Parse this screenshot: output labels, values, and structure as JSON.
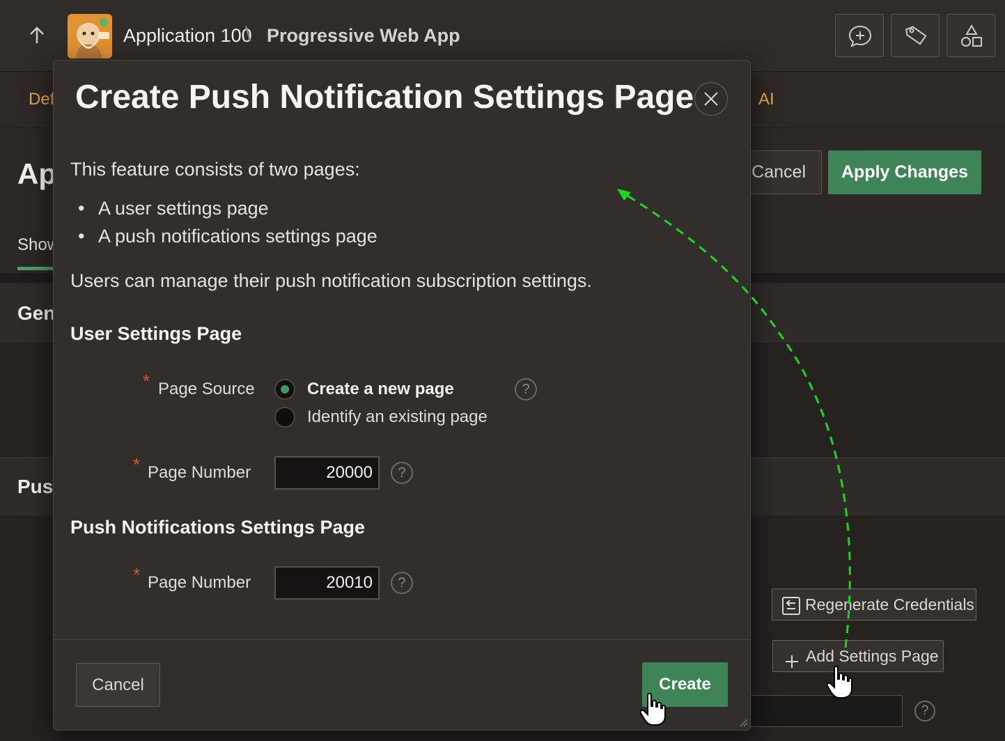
{
  "header": {
    "app_name": "Application 100",
    "crumb_separator": "\\",
    "page_name": "Progressive Web App",
    "tools": [
      "comment-add-icon",
      "tag-icon",
      "shapes-icon"
    ]
  },
  "tabs": {
    "left_label": "Def",
    "right_label": "AI"
  },
  "background": {
    "page_heading": "Ap",
    "show_label": "Show",
    "cancel_label": "Cancel",
    "apply_label": "Apply Changes",
    "general_region": "Gen",
    "push_region": "Pusl",
    "regen_label": "Regenerate Credentials",
    "add_settings_label": "Add Settings Page",
    "help_glyph": "?"
  },
  "dialog": {
    "title": "Create Push Notification Settings Page",
    "intro": "This feature consists of two pages:",
    "bullets": [
      "A user settings page",
      "A push notifications settings page"
    ],
    "description": "Users can manage their push notification subscription settings.",
    "user_section": {
      "heading": "User Settings Page",
      "page_source_label": "Page Source",
      "options": [
        "Create a new page",
        "Identify an existing page"
      ],
      "selected_option": "Create a new page",
      "page_number_label": "Page Number",
      "page_number_value": "20000"
    },
    "push_section": {
      "heading": "Push Notifications Settings Page",
      "page_number_label": "Page Number",
      "page_number_value": "20010"
    },
    "cancel_label": "Cancel",
    "create_label": "Create",
    "required_marker": "*",
    "help_glyph": "?",
    "bullet_glyph": "•"
  },
  "colors": {
    "accent_green": "#3f8456",
    "tab_orange": "#f0a74a",
    "required_red": "#d8553b",
    "annotation_arrow": "#1ed61e"
  }
}
